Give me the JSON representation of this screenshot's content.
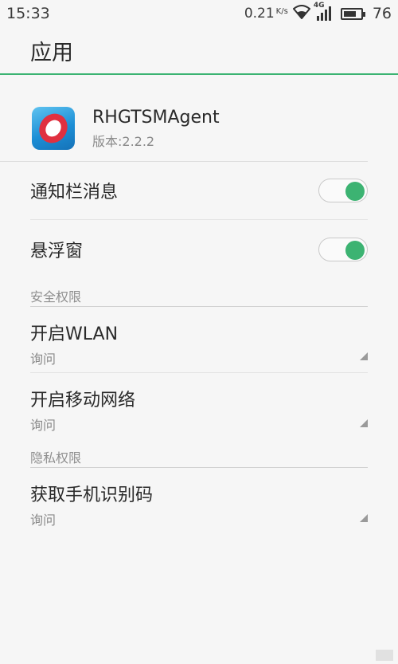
{
  "status_bar": {
    "time": "15:33",
    "net_speed": "0.21",
    "net_unit": "K/s",
    "network_type": "4G",
    "battery_level": "76"
  },
  "app_bar": {
    "title": "应用"
  },
  "app_info": {
    "name": "RHGTSMAgent",
    "version": "版本:2.2.2"
  },
  "toggles": [
    {
      "label": "通知栏消息",
      "on": true
    },
    {
      "label": "悬浮窗",
      "on": true
    }
  ],
  "sections": [
    {
      "title": "安全权限",
      "items": [
        {
          "title": "开启WLAN",
          "value": "询问"
        },
        {
          "title": "开启移动网络",
          "value": "询问"
        }
      ]
    },
    {
      "title": "隐私权限",
      "items": [
        {
          "title": "获取手机识别码",
          "value": "询问"
        }
      ]
    }
  ],
  "colors": {
    "accent": "#3cb372",
    "app_icon_blue": "#1d8fd6",
    "app_icon_red": "#e03040"
  }
}
